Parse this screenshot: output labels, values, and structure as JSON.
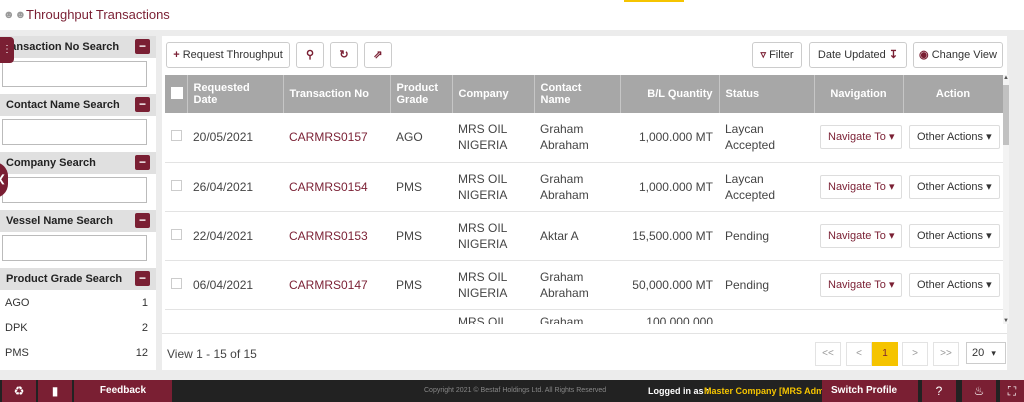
{
  "header": {
    "title": "Throughput Transactions"
  },
  "filters": {
    "transaction_no": "ransaction No Search",
    "contact_name": "Contact Name Search",
    "company": "Company Search",
    "vessel_name": "Vessel Name Search",
    "product_grade": "Product Grade Search",
    "minus": "−",
    "grades": [
      {
        "name": "AGO",
        "count": "1"
      },
      {
        "name": "DPK",
        "count": "2"
      },
      {
        "name": "PMS",
        "count": "12"
      }
    ]
  },
  "toolbar": {
    "request_throughput": "Request Throughput",
    "filter": "Filter",
    "date_updated": "Date Updated",
    "change_view": "Change View"
  },
  "table": {
    "columns": [
      "Requested Date",
      "Transaction No",
      "Product Grade",
      "Company",
      "Contact Name",
      "B/L Quantity",
      "Status",
      "Navigation",
      "Action"
    ],
    "navigate_label": "Navigate To ▾",
    "other_label": "Other Actions ▾",
    "rows": [
      {
        "date": "20/05/2021",
        "txn": "CARMRS0157",
        "grade": "AGO",
        "company": "MRS OIL NIGERIA",
        "contact": "Graham Abraham",
        "qty": "1,000.000 MT",
        "status": "Laycan Accepted"
      },
      {
        "date": "26/04/2021",
        "txn": "CARMRS0154",
        "grade": "PMS",
        "company": "MRS OIL NIGERIA",
        "contact": "Graham Abraham",
        "qty": "1,000.000 MT",
        "status": "Laycan Accepted"
      },
      {
        "date": "22/04/2021",
        "txn": "CARMRS0153",
        "grade": "PMS",
        "company": "MRS OIL NIGERIA",
        "contact": "Aktar A",
        "qty": "15,500.000 MT",
        "status": "Pending"
      },
      {
        "date": "06/04/2021",
        "txn": "CARMRS0147",
        "grade": "PMS",
        "company": "MRS OIL NIGERIA",
        "contact": "Graham Abraham",
        "qty": "50,000.000 MT",
        "status": "Pending"
      }
    ],
    "partial_row": {
      "company": "MRS OIL",
      "contact": "Graham",
      "qty": "100,000.000"
    }
  },
  "pager": {
    "info": "View 1 - 15 of 15",
    "first": "<<",
    "prev": "<",
    "current": "1",
    "next": ">",
    "last": ">>",
    "page_size": "20"
  },
  "footer": {
    "feedback": "Feedback",
    "copyright": "Copyright 2021 © Bestaf Holdings Ltd. All Rights Reserved",
    "logged_in_label": "Logged in as :",
    "company": "Master Company [MRS Admin]",
    "switch_profile": "Switch Profile"
  }
}
